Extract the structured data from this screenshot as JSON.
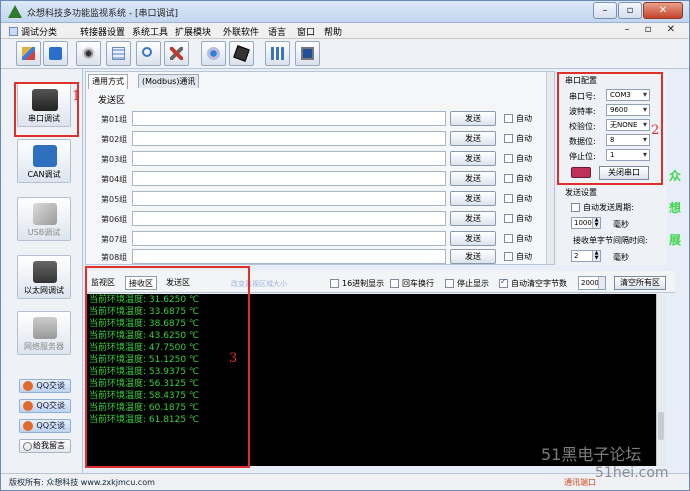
{
  "window": {
    "title": "众想科技多功能监视系统 - [串口调试]",
    "controls": [
      "–",
      "▫",
      "✕"
    ],
    "mdi_controls": "– ▫ ✕"
  },
  "menu": [
    {
      "label": "调试分类"
    },
    {
      "label": "转接器设置"
    },
    {
      "label": "系统工具"
    },
    {
      "label": "扩展模块"
    },
    {
      "label": "外联软件"
    },
    {
      "label": "语言"
    },
    {
      "label": "窗口"
    },
    {
      "label": "帮助"
    }
  ],
  "toolbar_icons": [
    "pencil-icon",
    "book-icon",
    "speaker-icon",
    "calculator-icon",
    "search-icon",
    "tools-icon",
    "camera-icon",
    "film-icon",
    "grid-icon",
    "monitor-icon"
  ],
  "sidebar": {
    "items": [
      {
        "label": "串口调试",
        "icon": "serial-port-icon"
      },
      {
        "label": "CAN调试",
        "icon": "can-chip-icon"
      },
      {
        "label": "USB调试",
        "icon": "usb-icon"
      },
      {
        "label": "以太网调试",
        "icon": "ethernet-icon"
      },
      {
        "label": "网络服务器",
        "icon": "network-server-icon"
      }
    ],
    "qq": [
      "QQ交谈",
      "QQ交谈",
      "QQ交谈"
    ],
    "message": "给我留言"
  },
  "send_panel": {
    "tabs": [
      "通用方式",
      "(Modbus)通讯"
    ],
    "label": "发送区",
    "rows": [
      {
        "label": "第01组",
        "button": "发送",
        "auto": "自动"
      },
      {
        "label": "第02组",
        "button": "发送",
        "auto": "自动"
      },
      {
        "label": "第03组",
        "button": "发送",
        "auto": "自动"
      },
      {
        "label": "第04组",
        "button": "发送",
        "auto": "自动"
      },
      {
        "label": "第05组",
        "button": "发送",
        "auto": "自动"
      },
      {
        "label": "第06组",
        "button": "发送",
        "auto": "自动"
      },
      {
        "label": "第07组",
        "button": "发送",
        "auto": "自动"
      },
      {
        "label": "第08组",
        "button": "发送",
        "auto": "自动"
      }
    ]
  },
  "port_config": {
    "title": "串口配置",
    "fields": [
      {
        "label": "串口号:",
        "value": "COM3"
      },
      {
        "label": "波特率:",
        "value": "9600"
      },
      {
        "label": "校验位:",
        "value": "无NONE"
      },
      {
        "label": "数据位:",
        "value": "8"
      },
      {
        "label": "停止位:",
        "value": "1"
      }
    ],
    "close_button": "关闭串口"
  },
  "send_settings": {
    "title": "发送设置",
    "auto_period_label": "自动发送周期:",
    "period_value": "1000",
    "period_unit": "毫秒",
    "byte_interval_label": "接收单字节间隔时间:",
    "interval_value": "2",
    "interval_unit": "毫秒"
  },
  "side_vertical_text": [
    "众",
    "想",
    "展"
  ],
  "receive": {
    "tabs": [
      "监视区",
      "接收区",
      "发送区"
    ],
    "hint": "改变监视区域大小",
    "options": [
      {
        "label": "16进制显示",
        "checked": false
      },
      {
        "label": "回车换行",
        "checked": false
      },
      {
        "label": "停止显示",
        "checked": false
      },
      {
        "label": "自动清空字节数",
        "checked": true
      }
    ],
    "clear_count": "2000",
    "clear_button": "清空所有区"
  },
  "terminal_lines": [
    "当前环境温度: 31.6250 ℃",
    "当前环境温度: 33.6875 ℃",
    "当前环境温度: 38.6875 ℃",
    "当前环境温度: 43.6250 ℃",
    "当前环境温度: 47.7500 ℃",
    "当前环境温度: 51.1250 ℃",
    "当前环境温度: 53.9375 ℃",
    "当前环境温度: 56.3125 ℃",
    "当前环境温度: 58.4375 ℃",
    "当前环境温度: 60.1875 ℃",
    "当前环境温度: 61.8125 ℃"
  ],
  "annotations": [
    "1",
    "2",
    "3"
  ],
  "status": {
    "left": "版权所有: 众想科技 www.zxkjmcu.com",
    "right": "通讯端口"
  },
  "watermark": {
    "line1": "51黑电子论坛",
    "line2": "51hei.com"
  },
  "colors": {
    "terminal_bg": "#000000",
    "terminal_text": "#39d13a",
    "annotation": "#e0302a"
  }
}
